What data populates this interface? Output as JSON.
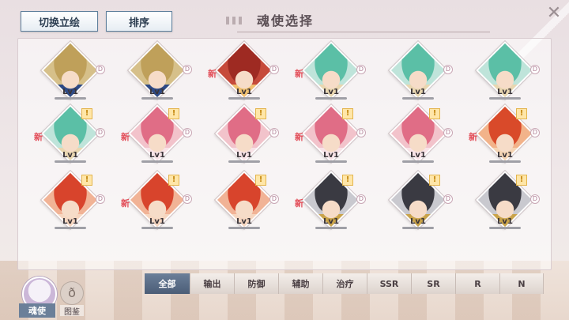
{
  "toolbar": {
    "switch_label": "切换立绘",
    "sort_label": "排序"
  },
  "title": "魂使选择",
  "close_glyph": "✕",
  "grid": {
    "rows": [
      [
        {
          "lv": "Lv1",
          "rank": "D",
          "is_new": false,
          "can_upgrade": false,
          "palette": "gold"
        },
        {
          "lv": "Lv1",
          "rank": "D",
          "is_new": false,
          "can_upgrade": false,
          "palette": "gold"
        },
        {
          "lv": "Lv1",
          "rank": "D",
          "is_new": true,
          "can_upgrade": false,
          "palette": "crimson"
        },
        {
          "lv": "Lv1",
          "rank": "D",
          "is_new": true,
          "can_upgrade": false,
          "palette": "teal"
        },
        {
          "lv": "Lv1",
          "rank": "D",
          "is_new": false,
          "can_upgrade": false,
          "palette": "teal"
        },
        {
          "lv": "Lv1",
          "rank": "D",
          "is_new": false,
          "can_upgrade": false,
          "palette": "teal"
        }
      ],
      [
        {
          "lv": "Lv1",
          "rank": "D",
          "is_new": true,
          "can_upgrade": true,
          "palette": "teal"
        },
        {
          "lv": "Lv1",
          "rank": "D",
          "is_new": true,
          "can_upgrade": true,
          "palette": "pink"
        },
        {
          "lv": "Lv1",
          "rank": "D",
          "is_new": false,
          "can_upgrade": true,
          "palette": "pink"
        },
        {
          "lv": "Lv1",
          "rank": "D",
          "is_new": true,
          "can_upgrade": true,
          "palette": "pink"
        },
        {
          "lv": "Lv1",
          "rank": "D",
          "is_new": false,
          "can_upgrade": true,
          "palette": "pink"
        },
        {
          "lv": "Lv1",
          "rank": "D",
          "is_new": true,
          "can_upgrade": true,
          "palette": "orange"
        }
      ],
      [
        {
          "lv": "Lv1",
          "rank": "D",
          "is_new": false,
          "can_upgrade": true,
          "palette": "red"
        },
        {
          "lv": "Lv1",
          "rank": "D",
          "is_new": true,
          "can_upgrade": true,
          "palette": "red"
        },
        {
          "lv": "Lv1",
          "rank": "D",
          "is_new": false,
          "can_upgrade": true,
          "palette": "red"
        },
        {
          "lv": "Lv1",
          "rank": "D",
          "is_new": true,
          "can_upgrade": true,
          "palette": "dark"
        },
        {
          "lv": "Lv1",
          "rank": "D",
          "is_new": false,
          "can_upgrade": true,
          "palette": "dark"
        },
        {
          "lv": "Lv1",
          "rank": "D",
          "is_new": false,
          "can_upgrade": true,
          "palette": "dark"
        }
      ]
    ],
    "new_label": "新",
    "upgrade_glyph": "!"
  },
  "filters": {
    "tabs": [
      "全部",
      "输出",
      "防御",
      "辅助",
      "治疗",
      "SSR",
      "SR",
      "R",
      "N"
    ],
    "active_index": 0
  },
  "bottom": {
    "avatar_label": "魂使",
    "codex_label": "图鉴",
    "codex_glyph": "ð"
  },
  "palettes": {
    "gold": {
      "bg": "#d6c08a",
      "hair": "#bfa05a",
      "accent": "#2e4a86"
    },
    "crimson": {
      "bg": "#c64a3b",
      "hair": "#9e2a22",
      "accent": "#f0c070"
    },
    "teal": {
      "bg": "#bfe4da",
      "hair": "#5bbfa6",
      "accent": "#e9d6b0"
    },
    "pink": {
      "bg": "#f2c3cb",
      "hair": "#e06d86",
      "accent": "#f8e3e7"
    },
    "orange": {
      "bg": "#f2b38a",
      "hair": "#d94a2a",
      "accent": "#f5d5b5"
    },
    "red": {
      "bg": "#f1b396",
      "hair": "#d8442c",
      "accent": "#f6d6c0"
    },
    "dark": {
      "bg": "#c9c9cf",
      "hair": "#3a3a42",
      "accent": "#c9a34a"
    }
  }
}
